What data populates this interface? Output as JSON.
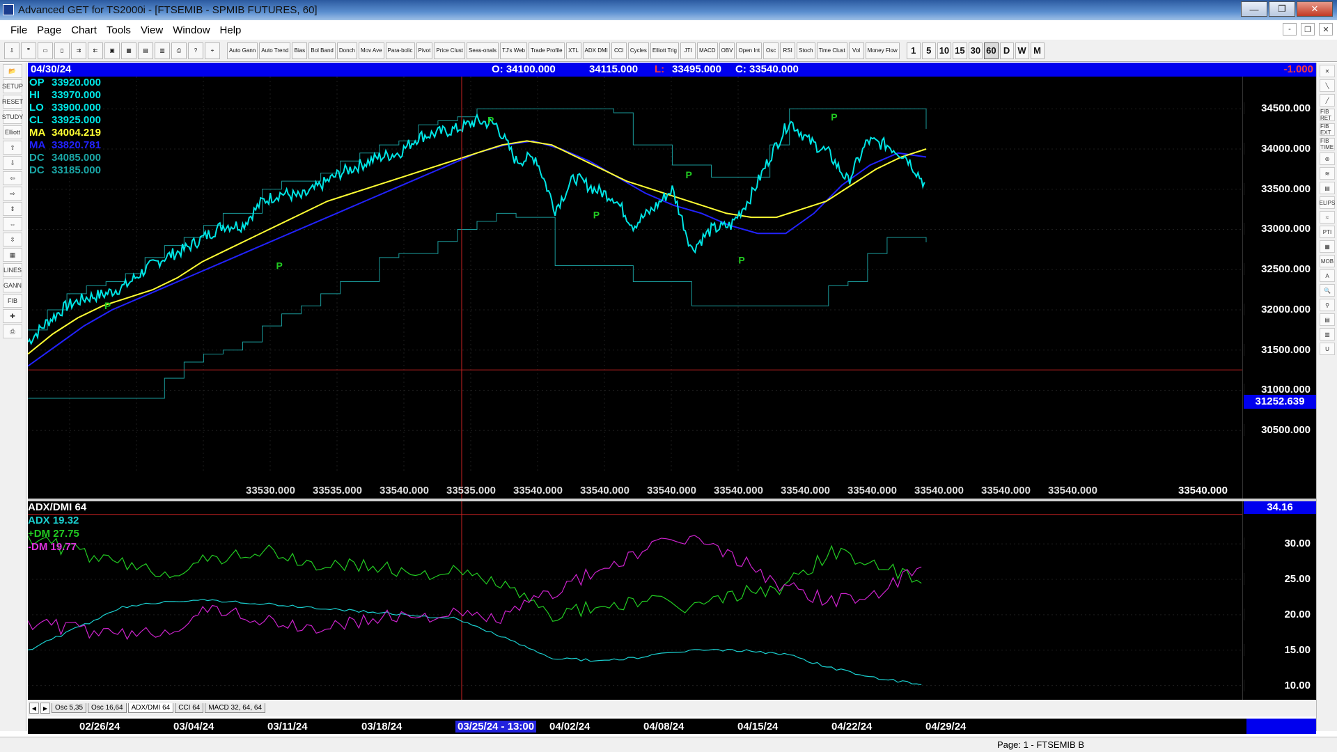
{
  "window": {
    "title": "Advanced GET for TS2000i - [FTSEMIB - SPMIB FUTURES, 60]",
    "min": "—",
    "max": "❐",
    "close": "✕"
  },
  "menu": [
    "File",
    "Page",
    "Chart",
    "Tools",
    "View",
    "Window",
    "Help"
  ],
  "mdi_buttons": [
    "-",
    "❐",
    "✕"
  ],
  "toolbar": {
    "file_tools": [
      "⇩",
      "❞",
      "▭",
      "▯",
      "⇉",
      "⇇",
      "▣",
      "▦",
      "▤",
      "▥",
      "⎙",
      "?",
      "⌖"
    ],
    "studies": [
      "Auto Gann",
      "Auto Trend",
      "Bias",
      "Bol Band",
      "Donch",
      "Mov Ave",
      "Para-bolic",
      "Pivot",
      "Price Clust",
      "Seas-onals",
      "TJ's Web",
      "Trade Profile",
      "XTL",
      "ADX DMI",
      "CCI",
      "Cycles",
      "Elliott Trig",
      "JTI",
      "MACD",
      "OBV",
      "Open Int",
      "Osc",
      "RSI",
      "Stoch",
      "Time Clust",
      "Vol",
      "Money Flow"
    ],
    "intervals": [
      "1",
      "5",
      "10",
      "15",
      "30",
      "60",
      "D",
      "W",
      "M"
    ],
    "active_interval": "60"
  },
  "left_tools": [
    "📂",
    "SETUP",
    "RESET",
    "STUDY",
    "Elliott",
    "⇧",
    "⇩",
    "⇦",
    "⇨",
    "⇕",
    "⇔",
    "⇳",
    "▦",
    "LINES",
    "GANN",
    "FIB",
    "✚",
    "⎙"
  ],
  "right_tools": [
    "✕",
    "╲",
    "╱",
    "FIB RET",
    "FIB EXT",
    "FIB TIME",
    "⊚",
    "≋",
    "▤",
    "ELIPS",
    "≈",
    "PTI",
    "▦",
    "MOB",
    "A",
    "🔍",
    "⚲",
    "▤",
    "▥",
    "U"
  ],
  "infobar": {
    "date": "04/30/24",
    "open": "O: 34100.000",
    "high": "34115.000",
    "low_label": "L:",
    "low": "33495.000",
    "close": "C: 33540.000",
    "change": "-1.000"
  },
  "readout": [
    {
      "key": "OP",
      "value": "33920.000",
      "color": "#00e5e5"
    },
    {
      "key": "HI",
      "value": "33970.000",
      "color": "#00e5e5"
    },
    {
      "key": "LO",
      "value": "33900.000",
      "color": "#00e5e5"
    },
    {
      "key": "CL",
      "value": "33925.000",
      "color": "#00e5e5"
    },
    {
      "key": "MA",
      "value": "34004.219",
      "color": "#ffff33"
    },
    {
      "key": "MA",
      "value": "33820.781",
      "color": "#2222ff"
    },
    {
      "key": "DC",
      "value": "34085.000",
      "color": "#1aa6a6"
    },
    {
      "key": "DC",
      "value": "33185.000",
      "color": "#1aa6a6"
    }
  ],
  "price_axis": [
    "34500.000",
    "34000.000",
    "33500.000",
    "33000.000",
    "32500.000",
    "32000.000",
    "31500.000",
    "31000.000",
    "30500.000"
  ],
  "crosshair_price": "31252.639",
  "bottom_values": [
    "33530.000",
    "33535.000",
    "33540.000",
    "33535.000",
    "33540.000",
    "33540.000",
    "33540.000",
    "33540.000",
    "33540.000",
    "33540.000",
    "33540.000",
    "33540.000",
    "33540.000",
    "33540.000",
    "33540.000"
  ],
  "indicator": {
    "title": "ADX/DMI 64",
    "adx": "ADX 19.32",
    "pdm": "+DM 27.75",
    "mdm": "-DM  19.77",
    "current": "34.16",
    "axis": [
      "30.00",
      "25.00",
      "20.00",
      "15.00",
      "10.00"
    ]
  },
  "tabs": [
    "Osc 5,35",
    "Osc 16,64",
    "ADX/DMI 64",
    "CCI 64",
    "MACD 32, 64, 64"
  ],
  "active_tab": "ADX/DMI 64",
  "dates": [
    "02/26/24",
    "03/04/24",
    "03/11/24",
    "03/18/24",
    "03/25/24 - 13:00",
    "04/02/24",
    "04/08/24",
    "04/15/24",
    "04/22/24",
    "04/29/24"
  ],
  "status": "Page: 1 - FTSEMIB B",
  "pivot_label": "P",
  "colors": {
    "price": "#00e5e5",
    "ma_fast": "#ffff33",
    "ma_slow": "#2222ff",
    "donchian": "#1a9a9a",
    "adx": "#1ad0d0",
    "pdm": "#22cc22",
    "mdm": "#cc22cc",
    "crosshair": "#cc2222"
  },
  "chart_data": {
    "type": "line",
    "title": "FTSEMIB - SPMIB FUTURES, 60",
    "ylim": [
      30000,
      34900
    ],
    "x": [
      "02/26/24",
      "03/04/24",
      "03/11/24",
      "03/18/24",
      "03/25/24",
      "04/02/24",
      "04/08/24",
      "04/15/24",
      "04/22/24",
      "04/29/24"
    ],
    "series": [
      {
        "values": [
          31600,
          31850,
          32050,
          32150,
          32200,
          32300,
          32500,
          32650,
          32750,
          32900,
          33050,
          33050,
          33350,
          33450,
          33400,
          33550,
          33700,
          33800,
          33900,
          33950,
          34150,
          34200,
          34250,
          34350,
          34300,
          33850,
          33900,
          33250,
          33650,
          33500,
          33400,
          33050,
          33250,
          33500,
          32750,
          33000,
          33050,
          33400,
          33900,
          34350,
          34100,
          33950,
          33600,
          34100,
          34050,
          33900,
          33540
        ]
      },
      {
        "values": [
          31450,
          31700,
          31900,
          32050,
          32150,
          32250,
          32400,
          32600,
          32750,
          32900,
          33050,
          33200,
          33350,
          33450,
          33550,
          33650,
          33750,
          33850,
          33950,
          34050,
          34100,
          34050,
          33900,
          33750,
          33600,
          33500,
          33400,
          33300,
          33200,
          33150,
          33150,
          33250,
          33350,
          33550,
          33750,
          33900,
          34000
        ]
      },
      {
        "values": [
          31300,
          31550,
          31800,
          32000,
          32150,
          32300,
          32450,
          32600,
          32750,
          32900,
          33050,
          33200,
          33350,
          33500,
          33650,
          33800,
          33950,
          34050,
          34100,
          34000,
          33850,
          33650,
          33450,
          33300,
          33200,
          33050,
          32950,
          32950,
          33200,
          33550,
          33800,
          33950,
          33900
        ]
      }
    ],
    "pivots": [
      {
        "x": "02/28/24",
        "y": 32050
      },
      {
        "x": "03/12/24",
        "y": 32550
      },
      {
        "x": "03/28/24",
        "y": 34360
      },
      {
        "x": "04/05/24",
        "y": 33180
      },
      {
        "x": "04/12/24",
        "y": 33680
      },
      {
        "x": "04/16/24",
        "y": 32620
      },
      {
        "x": "04/23/24",
        "y": 34400
      }
    ]
  }
}
